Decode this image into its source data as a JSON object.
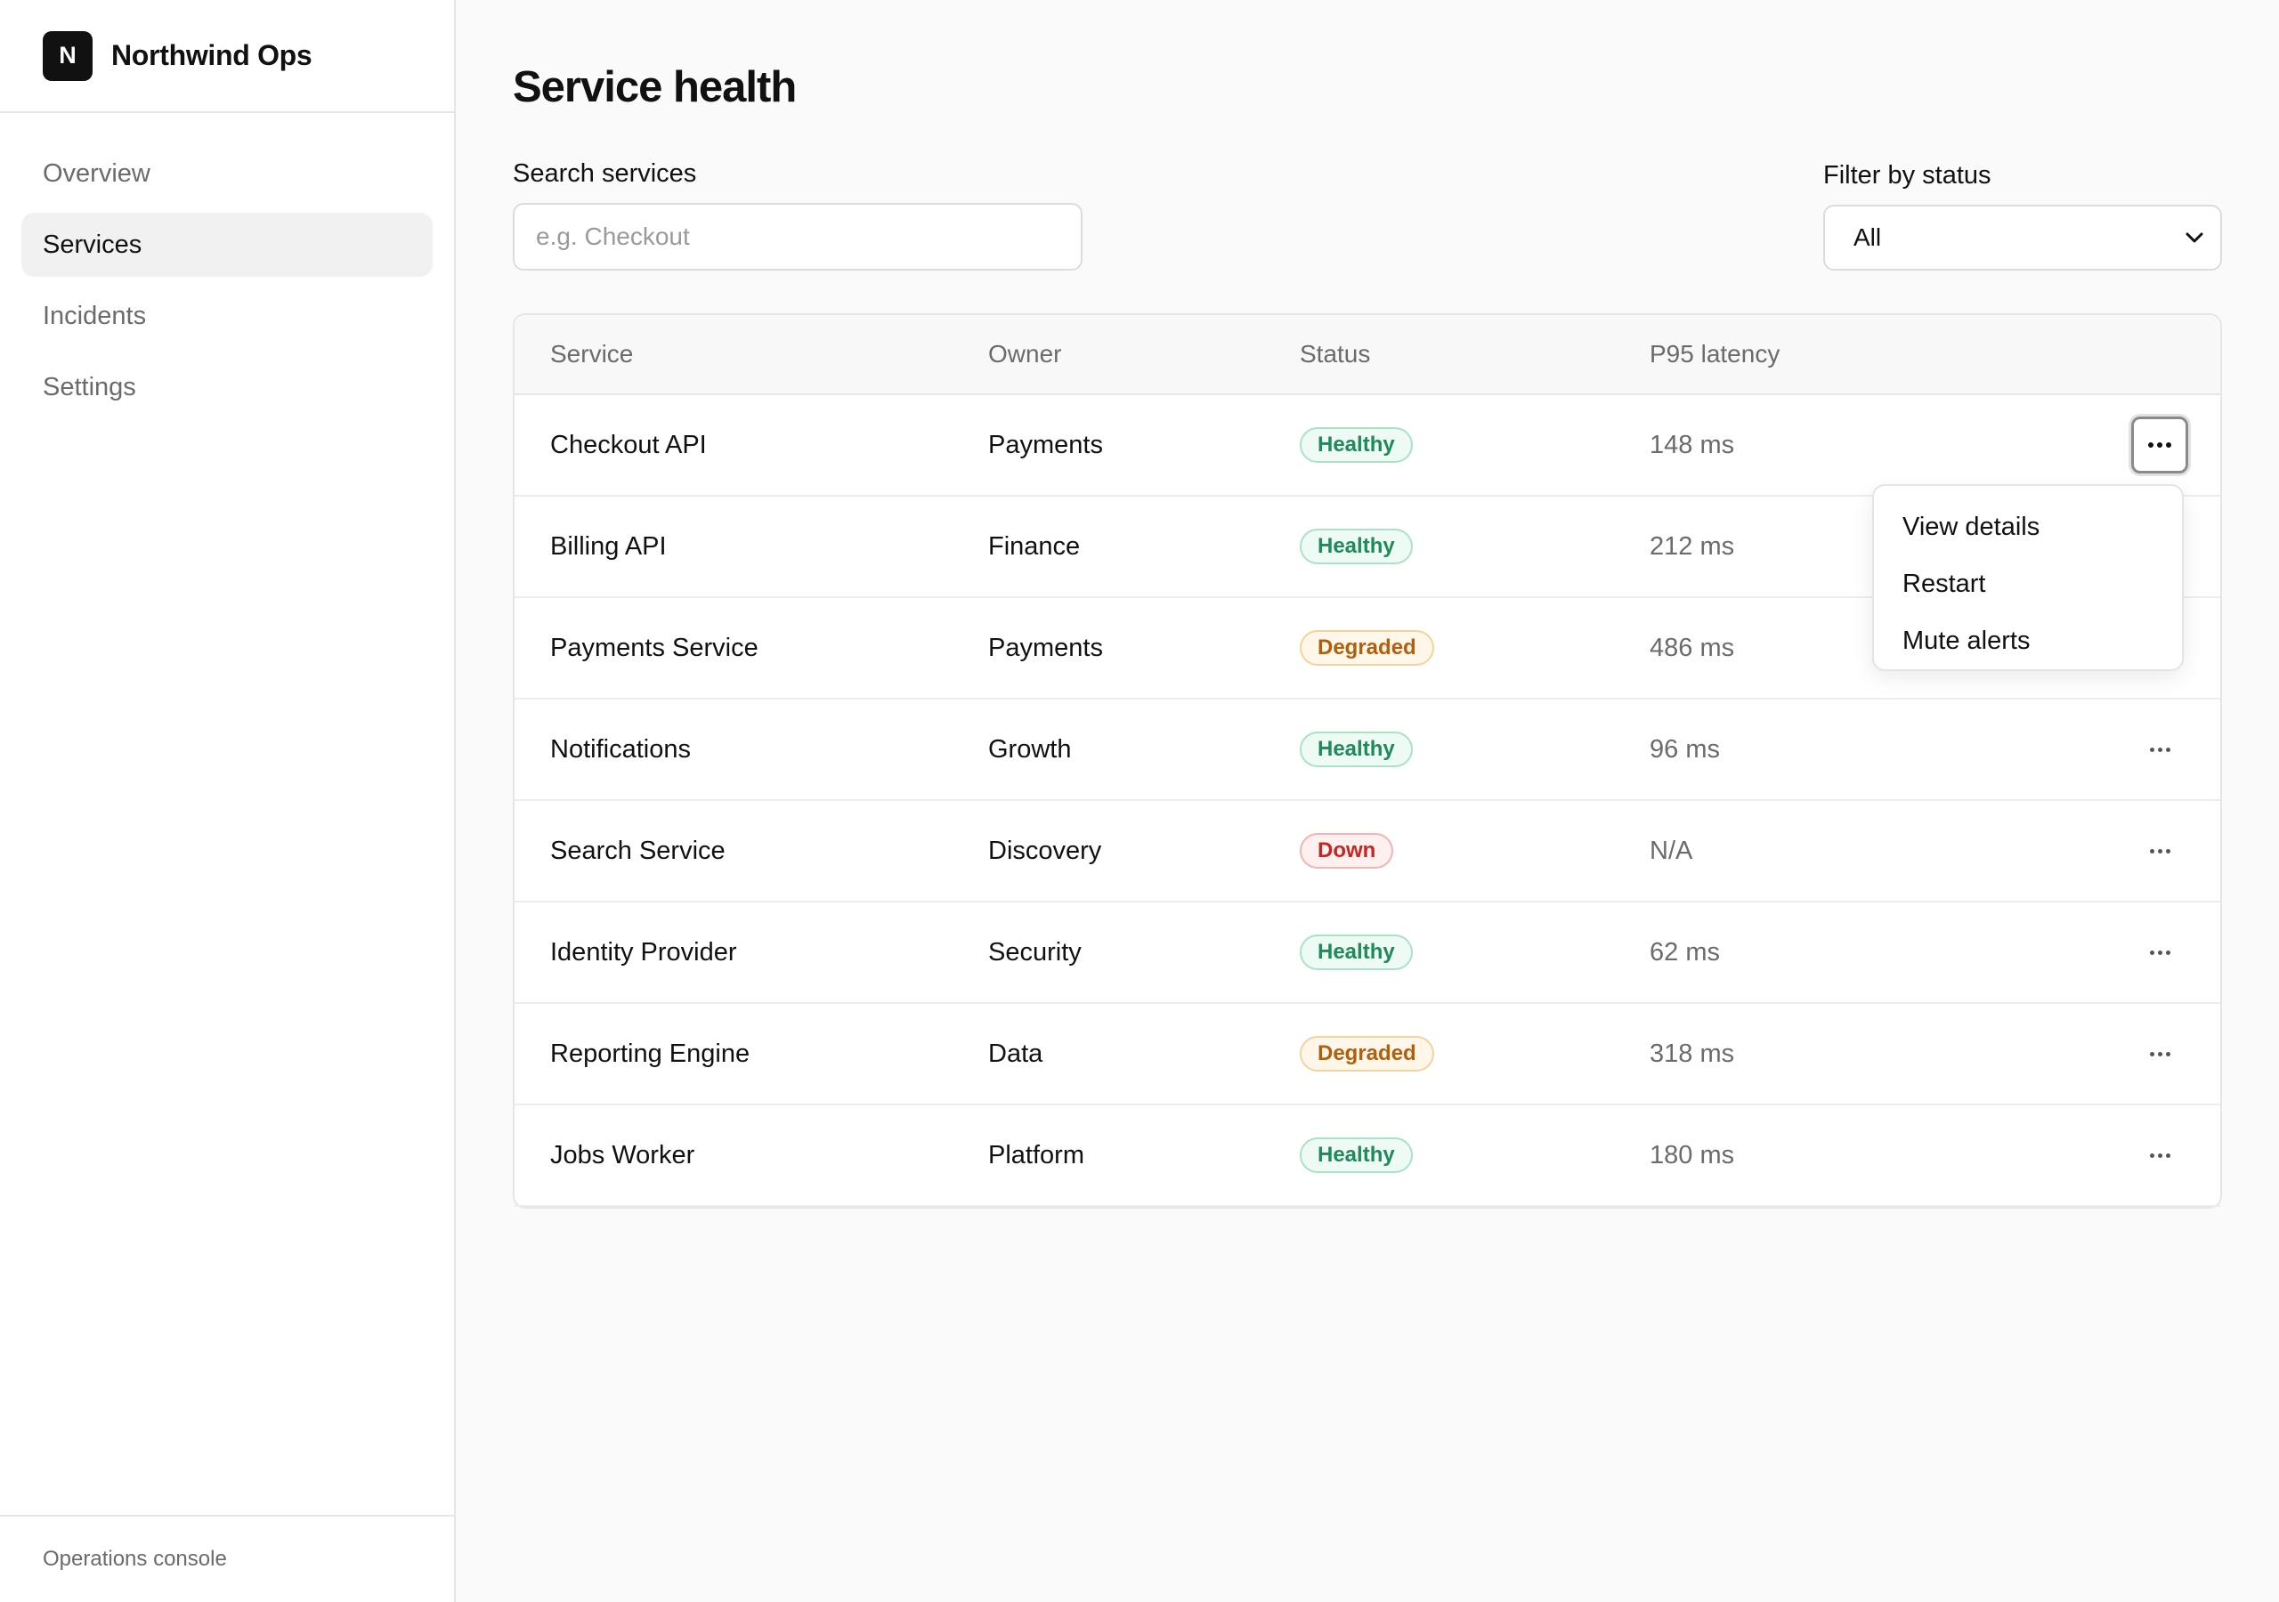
{
  "brand": {
    "logo_letter": "N",
    "name": "Northwind Ops"
  },
  "sidebar": {
    "items": [
      {
        "label": "Overview",
        "active": false
      },
      {
        "label": "Services",
        "active": true
      },
      {
        "label": "Incidents",
        "active": false
      },
      {
        "label": "Settings",
        "active": false
      }
    ],
    "footer": "Operations console"
  },
  "main": {
    "title": "Service health",
    "search": {
      "label": "Search services",
      "placeholder": "e.g. Checkout",
      "value": ""
    },
    "filter": {
      "label": "Filter by status",
      "selected": "All"
    }
  },
  "table": {
    "headers": {
      "service": "Service",
      "owner": "Owner",
      "status": "Status",
      "latency": "P95 latency"
    },
    "rows": [
      {
        "service": "Checkout API",
        "owner": "Payments",
        "status": "Healthy",
        "latency": "148 ms"
      },
      {
        "service": "Billing API",
        "owner": "Finance",
        "status": "Healthy",
        "latency": "212 ms"
      },
      {
        "service": "Payments Service",
        "owner": "Payments",
        "status": "Degraded",
        "latency": "486 ms"
      },
      {
        "service": "Notifications",
        "owner": "Growth",
        "status": "Healthy",
        "latency": "96 ms"
      },
      {
        "service": "Search Service",
        "owner": "Discovery",
        "status": "Down",
        "latency": "N/A"
      },
      {
        "service": "Identity Provider",
        "owner": "Security",
        "status": "Healthy",
        "latency": "62 ms"
      },
      {
        "service": "Reporting Engine",
        "owner": "Data",
        "status": "Degraded",
        "latency": "318 ms"
      },
      {
        "service": "Jobs Worker",
        "owner": "Platform",
        "status": "Healthy",
        "latency": "180 ms"
      }
    ]
  },
  "row_menu": {
    "open_for_row": "Checkout API",
    "items": [
      "View details",
      "Restart",
      "Mute alerts"
    ]
  },
  "icons": {
    "row_actions": "more-horizontal-icon",
    "select": "chevron-down-icon"
  },
  "colors": {
    "healthy": "#1f8a5a",
    "degraded": "#b25f0c",
    "down": "#c42525",
    "brand_logo_bg": "#111111"
  }
}
